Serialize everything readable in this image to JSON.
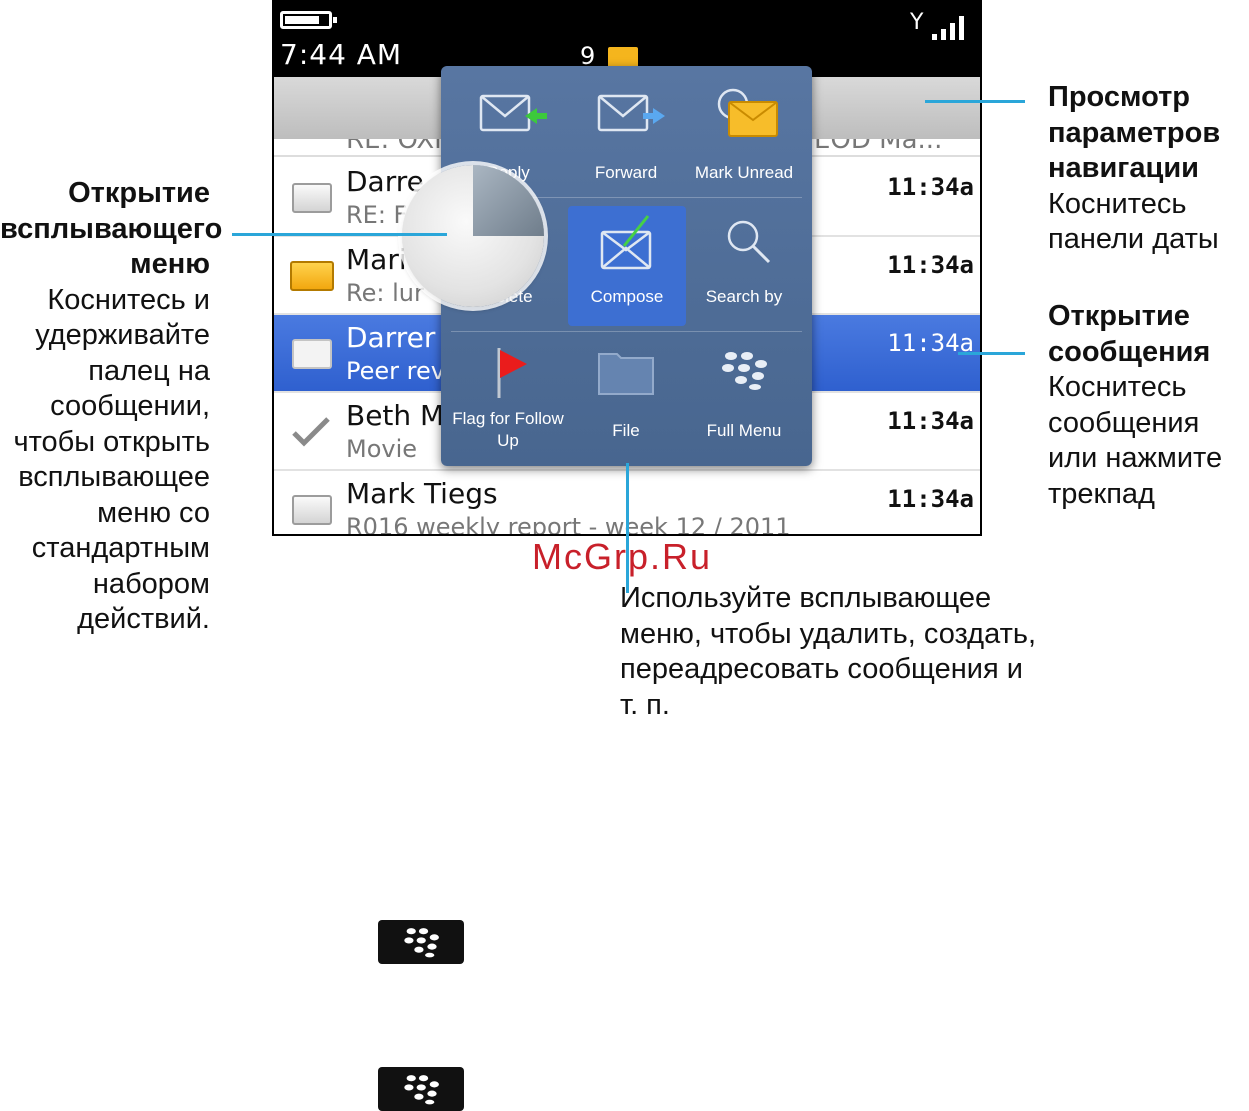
{
  "status_bar": {
    "time": "7:44 AM",
    "unread_count": "9",
    "battery_level": 0.8
  },
  "list": {
    "partial_row": {
      "left_text": "RE: OXI",
      "right_text": "EOD Ma..."
    },
    "messages": [
      {
        "sender": "Darre",
        "subject": "RE: F",
        "time": "11:34a",
        "icon": "envelope-open-icon",
        "selected": false
      },
      {
        "sender": "Mari",
        "subject": "Re: lur",
        "time": "11:34a",
        "icon": "envelope-unread-icon",
        "selected": false
      },
      {
        "sender": "Darrer",
        "subject": "Peer rev",
        "time": "11:34a",
        "icon": "envelope-attachment-icon",
        "selected": true
      },
      {
        "sender": "Beth M",
        "subject": "Movie",
        "time": "11:34a",
        "icon": "checkmark-icon",
        "selected": false
      },
      {
        "sender": "Mark Tiegs",
        "subject": "R016 weekly report - week 12 / 2011",
        "time": "11:34a",
        "icon": "envelope-open-icon",
        "selected": false
      }
    ]
  },
  "popup": {
    "items": [
      {
        "label": "Reply",
        "icon": "reply-icon"
      },
      {
        "label": "Forward",
        "icon": "forward-icon"
      },
      {
        "label": "Mark Unread",
        "icon": "mark-unread-icon"
      },
      {
        "label": "Delete",
        "icon": "delete-icon"
      },
      {
        "label": "Compose",
        "icon": "compose-icon"
      },
      {
        "label": "Search by",
        "icon": "search-icon"
      },
      {
        "label": "Flag for Follow Up",
        "icon": "flag-icon"
      },
      {
        "label": "File",
        "icon": "folder-icon"
      },
      {
        "label": "Full Menu",
        "icon": "blackberry-icon"
      }
    ]
  },
  "callouts": {
    "popup_open": {
      "heading": "Открытие всплывающего меню",
      "body": "Коснитесь и удерживайте палец на сообщении, чтобы открыть всплывающее меню со стандартным набором действий."
    },
    "navigation": {
      "heading": "Просмотр параметров навигации",
      "body": "Коснитесь панели даты"
    },
    "open_message": {
      "heading": "Открытие сообщения",
      "body": "Коснитесь сообщения или нажмите трекпад"
    },
    "usage": {
      "body": "Используйте всплывающее меню, чтобы удалить, создать, переадресовать сообщения и т. п."
    }
  },
  "watermark": "McGrp.Ru",
  "colors": {
    "accent": "#2aa6d9",
    "selected_row": "#3a6bd6",
    "popup_bg": "#51709b",
    "watermark": "#c8202a"
  }
}
